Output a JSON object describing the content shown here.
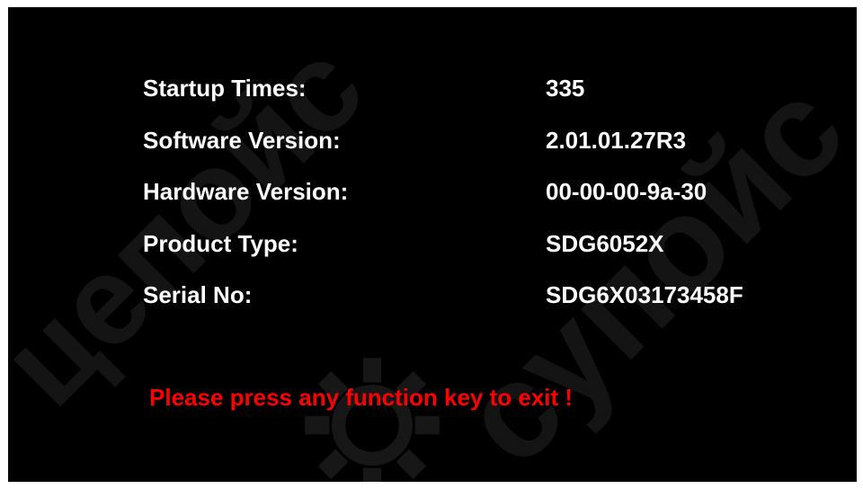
{
  "info": {
    "rows": [
      {
        "label": "Startup Times:",
        "value": "335"
      },
      {
        "label": "Software Version:",
        "value": "2.01.01.27R3"
      },
      {
        "label": "Hardware Version:",
        "value": "00-00-00-9a-30"
      },
      {
        "label": "Product Type:",
        "value": "SDG6052X"
      },
      {
        "label": "Serial No:",
        "value": "SDG6X03173458F"
      }
    ]
  },
  "exit_message": "Please press any function key to exit !",
  "watermark": {
    "text_left": "цепойс",
    "text_right": "супойс",
    "icon": "gear-icon"
  },
  "colors": {
    "background": "#000000",
    "text": "#ffffff",
    "warning": "#ff0000"
  }
}
